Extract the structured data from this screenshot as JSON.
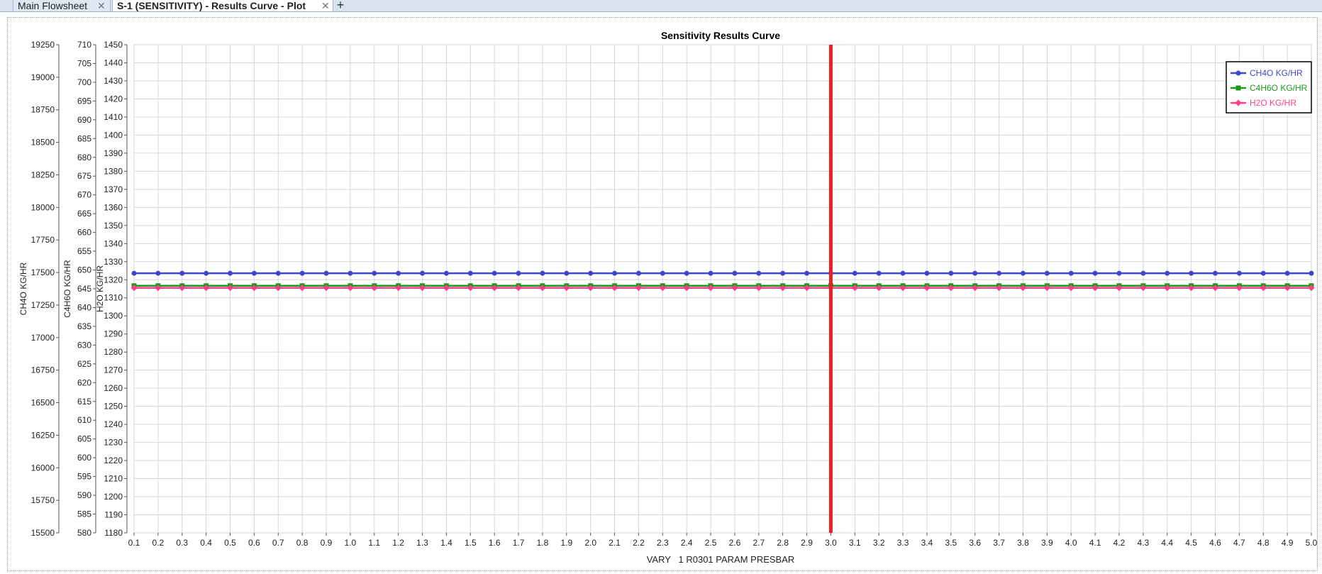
{
  "tabs": [
    {
      "label": "Main Flowsheet"
    },
    {
      "label": "S-1 (SENSITIVITY) - Results Curve - Plot"
    }
  ],
  "chart_data": {
    "type": "line",
    "title": "Sensitivity Results Curve",
    "xlabel": "VARY   1 R0301 PARAM PRESBAR",
    "x": [
      0.1,
      0.2,
      0.3,
      0.4,
      0.5,
      0.6,
      0.7,
      0.8,
      0.9,
      1.0,
      1.1,
      1.2,
      1.3,
      1.4,
      1.5,
      1.6,
      1.7,
      1.8,
      1.9,
      2.0,
      2.1,
      2.2,
      2.3,
      2.4,
      2.5,
      2.6,
      2.7,
      2.8,
      2.9,
      3.0,
      3.1,
      3.2,
      3.3,
      3.4,
      3.5,
      3.6,
      3.7,
      3.8,
      3.9,
      4.0,
      4.1,
      4.2,
      4.3,
      4.4,
      4.5,
      4.6,
      4.7,
      4.8,
      4.9,
      5.0
    ],
    "x_tick_labels": [
      "0.1",
      "0.2",
      "0.3",
      "0.4",
      "0.5",
      "0.6",
      "0.7",
      "0.8",
      "0.9",
      "1.0",
      "1.1",
      "1.2",
      "1.3",
      "1.4",
      "1.5",
      "1.6",
      "1.7",
      "1.8",
      "1.9",
      "2.0",
      "2.1",
      "2.2",
      "2.3",
      "2.4",
      "2.5",
      "2.6",
      "2.7",
      "2.8",
      "2.9",
      "3.0",
      "3.1",
      "3.2",
      "3.3",
      "3.4",
      "3.5",
      "3.6",
      "3.7",
      "3.8",
      "3.9",
      "4.0",
      "4.1",
      "4.2",
      "4.3",
      "4.4",
      "4.5",
      "4.6",
      "4.7",
      "4.8",
      "4.9",
      "5.0"
    ],
    "xlim": [
      0.1,
      5.0
    ],
    "grid": true,
    "legend_position": "top-right",
    "marker_x": 3.0,
    "marker_color": "#e8202a",
    "axes": [
      {
        "label": "CH4O KG/HR",
        "ylim": [
          15500,
          19250
        ],
        "tick_labels": [
          "15500",
          "15750",
          "16000",
          "16250",
          "16500",
          "16750",
          "17000",
          "17250",
          "17500",
          "17750",
          "18000",
          "18250",
          "18500",
          "18750",
          "19000",
          "19250"
        ]
      },
      {
        "label": "C4H6O KG/HR",
        "ylim": [
          580,
          710
        ],
        "tick_labels": [
          "580",
          "585",
          "590",
          "595",
          "600",
          "605",
          "610",
          "615",
          "620",
          "625",
          "630",
          "635",
          "640",
          "645",
          "650",
          "655",
          "660",
          "665",
          "670",
          "675",
          "680",
          "685",
          "690",
          "695",
          "700",
          "705",
          "710"
        ]
      },
      {
        "label": "H2O KG/HR",
        "ylim": [
          1180,
          1450
        ],
        "tick_labels": [
          "1180",
          "1190",
          "1200",
          "1210",
          "1220",
          "1230",
          "1240",
          "1250",
          "1260",
          "1270",
          "1280",
          "1290",
          "1300",
          "1310",
          "1320",
          "1330",
          "1340",
          "1350",
          "1360",
          "1370",
          "1380",
          "1390",
          "1400",
          "1410",
          "1420",
          "1430",
          "1440",
          "1450"
        ]
      }
    ],
    "series": [
      {
        "name": "CH4O KG/HR",
        "axis": 0,
        "color": "#3f47c8",
        "marker": "circle",
        "constant": 17494
      },
      {
        "name": "C4H6O KG/HR",
        "axis": 1,
        "color": "#1a9a1a",
        "marker": "square",
        "constant": 645.8
      },
      {
        "name": "H2O KG/HR",
        "axis": 2,
        "color": "#ff3d8b",
        "marker": "diamond",
        "constant": 1315.5
      }
    ]
  }
}
